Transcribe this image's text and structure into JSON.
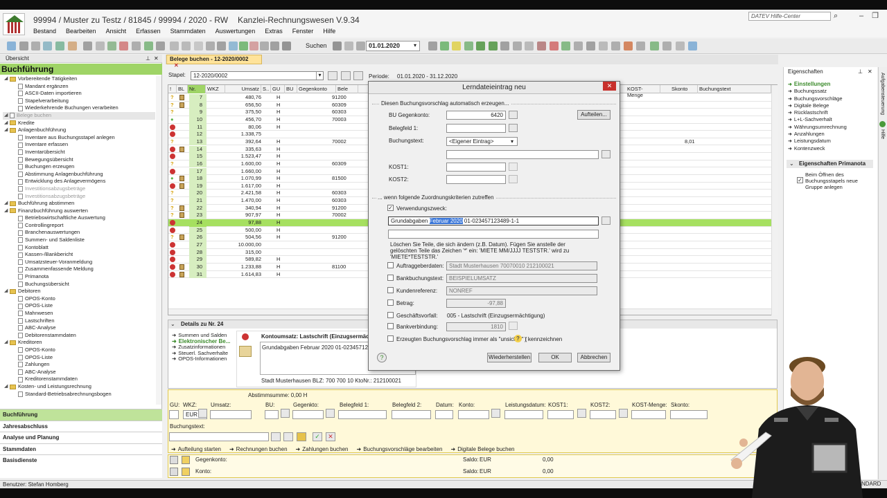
{
  "window": {
    "title": "99994 / Muster zu Testz / 81845 / 99994 / 2020 - RW",
    "app": "Kanzlei-Rechnungswesen V.9.34",
    "help_placeholder": "DATEV Hilfe-Center"
  },
  "menu": [
    "Bestand",
    "Bearbeiten",
    "Ansicht",
    "Erfassen",
    "Stammdaten",
    "Auswertungen",
    "Extras",
    "Fenster",
    "Hilfe"
  ],
  "toolbar": {
    "suchen": "Suchen",
    "date": "01.01.2020"
  },
  "leftpanel": {
    "header": "Übersicht",
    "title": "Buchführung",
    "tree": [
      {
        "t": "Vorbereitende Tätigkeiten",
        "lvl": 0,
        "f": 1
      },
      {
        "t": "Mandant ergänzen",
        "lvl": 1
      },
      {
        "t": "ASCII-Daten importieren",
        "lvl": 1
      },
      {
        "t": "Stapelverarbeitung",
        "lvl": 1
      },
      {
        "t": "Wiederkehrende Buchungen verarbeiten",
        "lvl": 1
      },
      {
        "t": "Belege buchen",
        "lvl": 0,
        "g": 1
      },
      {
        "t": "Kredite",
        "lvl": 0,
        "f": 1
      },
      {
        "t": "Anlagenbuchführung",
        "lvl": 0,
        "f": 1
      },
      {
        "t": "Inventare aus Buchungsstapel anlegen",
        "lvl": 1
      },
      {
        "t": "Inventare erfassen",
        "lvl": 1
      },
      {
        "t": "Inventarübersicht",
        "lvl": 1
      },
      {
        "t": "Bewegungsübersicht",
        "lvl": 1
      },
      {
        "t": "Buchungen erzeugen",
        "lvl": 1
      },
      {
        "t": "Abstimmung Anlagenbuchführung",
        "lvl": 1
      },
      {
        "t": "Entwicklung des Anlagevermögens",
        "lvl": 1
      },
      {
        "t": "Investitionsabzugsbeträge",
        "lvl": 1,
        "g": 1
      },
      {
        "t": "Investitionsabzugsbeträge",
        "lvl": 1,
        "g": 1
      },
      {
        "t": "Buchführung abstimmen",
        "lvl": 0,
        "f": 1
      },
      {
        "t": "Finanzbuchführung auswerten",
        "lvl": 0,
        "f": 1
      },
      {
        "t": "Betriebswirtschaftliche Auswertung",
        "lvl": 1
      },
      {
        "t": "Controllingreport",
        "lvl": 1
      },
      {
        "t": "Branchenauswertungen",
        "lvl": 1
      },
      {
        "t": "Summen- und Saldenliste",
        "lvl": 1
      },
      {
        "t": "Kontoblatt",
        "lvl": 1
      },
      {
        "t": "Kassen-/Bankbericht",
        "lvl": 1
      },
      {
        "t": "Umsatzsteuer-Voranmeldung",
        "lvl": 1
      },
      {
        "t": "Zusammenfassende Meldung",
        "lvl": 1
      },
      {
        "t": "Primanota",
        "lvl": 1
      },
      {
        "t": "Buchungsübersicht",
        "lvl": 1
      },
      {
        "t": "Debitoren",
        "lvl": 0,
        "f": 1
      },
      {
        "t": "OPOS-Konto",
        "lvl": 1
      },
      {
        "t": "OPOS-Liste",
        "lvl": 1
      },
      {
        "t": "Mahnwesen",
        "lvl": 1
      },
      {
        "t": "Lastschriften",
        "lvl": 1
      },
      {
        "t": "ABC-Analyse",
        "lvl": 1
      },
      {
        "t": "Debitorenstammdaten",
        "lvl": 1
      },
      {
        "t": "Kreditoren",
        "lvl": 0,
        "f": 1
      },
      {
        "t": "OPOS-Konto",
        "lvl": 1
      },
      {
        "t": "OPOS-Liste",
        "lvl": 1
      },
      {
        "t": "Zahlungen",
        "lvl": 1
      },
      {
        "t": "ABC-Analyse",
        "lvl": 1
      },
      {
        "t": "Kreditorenstammdaten",
        "lvl": 1
      },
      {
        "t": "Kosten- und Leistungsrechnung",
        "lvl": 0,
        "f": 1
      },
      {
        "t": "Standard-Betriebsabrechnungsbogen",
        "lvl": 1
      }
    ],
    "nav": [
      "Buchführung",
      "Jahresabschluss",
      "Analyse und Planung",
      "Stammdaten",
      "Basisdienste"
    ]
  },
  "main": {
    "tab": "Belege buchen - 12-2020/0002",
    "stapel_label": "Stapel:",
    "stapel_value": "12-2020/0002",
    "periode_label": "Periode:",
    "periode_value": "01.01.2020 - 31.12.2020",
    "columns": [
      "!",
      "BL",
      "Nr.",
      "WKZ",
      "Umsatz",
      "S..",
      "GU",
      "BU",
      "Gegenkonto",
      "Bele",
      "KOST-Menge",
      "Skonto",
      "Buchungstext"
    ],
    "rows": [
      {
        "s": "w",
        "bl": 1,
        "nr": "7",
        "u": "480,76",
        "h": "H",
        "g": "91200"
      },
      {
        "s": "w",
        "bl": 1,
        "nr": "8",
        "u": "656,50",
        "h": "H",
        "g": "60309"
      },
      {
        "s": "w",
        "bl": 0,
        "nr": "9",
        "u": "375,50",
        "h": "H",
        "g": "60303"
      },
      {
        "s": "b",
        "bl": 0,
        "nr": "10",
        "u": "456,70",
        "h": "H",
        "g": "70003"
      },
      {
        "s": "s",
        "bl": 0,
        "nr": "11",
        "u": "80,06",
        "h": "H",
        "g": ""
      },
      {
        "s": "s",
        "bl": 0,
        "nr": "12",
        "u": "1.338,75",
        "h": "",
        "g": ""
      },
      {
        "s": "w",
        "bl": 0,
        "nr": "13",
        "u": "392,64",
        "h": "H",
        "g": "70002",
        "sk": "8,01"
      },
      {
        "s": "s",
        "bl": 1,
        "nr": "14",
        "u": "335,63",
        "h": "H",
        "g": ""
      },
      {
        "s": "s",
        "bl": 0,
        "nr": "15",
        "u": "1.523,47",
        "h": "H",
        "g": ""
      },
      {
        "s": "w",
        "bl": 0,
        "nr": "16",
        "u": "1.600,00",
        "h": "H",
        "g": "60309"
      },
      {
        "s": "s",
        "bl": 0,
        "nr": "17",
        "u": "1.660,00",
        "h": "H",
        "g": ""
      },
      {
        "s": "b",
        "bl": 1,
        "nr": "18",
        "u": "1.070,99",
        "h": "H",
        "g": "81500"
      },
      {
        "s": "s",
        "bl": 1,
        "nr": "19",
        "u": "1.617,00",
        "h": "H",
        "g": ""
      },
      {
        "s": "w",
        "bl": 0,
        "nr": "20",
        "u": "2.421,58",
        "h": "H",
        "g": "60303"
      },
      {
        "s": "w",
        "bl": 0,
        "nr": "21",
        "u": "1.470,00",
        "h": "H",
        "g": "60303"
      },
      {
        "s": "w",
        "bl": 1,
        "nr": "22",
        "u": "340,94",
        "h": "H",
        "g": "91200"
      },
      {
        "s": "w",
        "bl": 1,
        "nr": "23",
        "u": "907,97",
        "h": "H",
        "g": "70002"
      },
      {
        "s": "s",
        "bl": 0,
        "nr": "24",
        "u": "97,88",
        "h": "H",
        "g": "",
        "sel": 1
      },
      {
        "s": "s",
        "bl": 0,
        "nr": "25",
        "u": "500,00",
        "h": "H",
        "g": ""
      },
      {
        "s": "w",
        "bl": 1,
        "nr": "26",
        "u": "504,56",
        "h": "H",
        "g": "91200"
      },
      {
        "s": "s",
        "bl": 0,
        "nr": "27",
        "u": "10.000,00",
        "h": "",
        "g": ""
      },
      {
        "s": "s",
        "bl": 0,
        "nr": "28",
        "u": "315,00",
        "h": "",
        "g": ""
      },
      {
        "s": "s",
        "bl": 0,
        "nr": "29",
        "u": "589,82",
        "h": "H",
        "g": ""
      },
      {
        "s": "s",
        "bl": 1,
        "nr": "30",
        "u": "1.233,88",
        "h": "H",
        "g": "81100"
      },
      {
        "s": "s",
        "bl": 1,
        "nr": "31",
        "u": "1.614,83",
        "h": "H",
        "g": ""
      }
    ]
  },
  "details": {
    "header": "Details zu Nr. 24",
    "links": [
      "Summen und Salden",
      "Elektronischer Be...",
      "Zusatzinformationen",
      "Steuerl. Sachverhalte",
      "OPOS-Informationen"
    ],
    "kontoumsatz": "Kontoumsatz: Lastschrift (Einzugsermäch",
    "text": "Grundabgaben Februar 2020 01-023457123489-",
    "bank": "Stadt Musterhausen   BLZ: 700 700 10   KtoNr.: 212100021"
  },
  "entry": {
    "abstimm": "Abstimmsumme: 0,00 H",
    "labels": [
      "GU:",
      "WKZ:",
      "Umsatz:",
      "BU:",
      "Gegenkto:",
      "Belegfeld 1:",
      "Belegfeld 2:",
      "Datum:",
      "Konto:",
      "Leistungsdatum:",
      "KOST1:",
      "KOST2:",
      "KOST-Menge:",
      "Skonto:"
    ],
    "wkz": "EUR",
    "buchungstext": "Buchungstext:",
    "actions": [
      "Aufteilung starten",
      "Rechnungen buchen",
      "Zahlungen buchen",
      "Buchungsvorschläge bearbeiten",
      "Digitale Belege buchen"
    ],
    "gegenkonto": "Gegenkonto:",
    "konto": "Konto:",
    "saldo": "Saldo:",
    "eur": "EUR",
    "zero": "0,00"
  },
  "props": {
    "header": "Eigenschaften",
    "items": [
      "Einstellungen",
      "Buchungssatz",
      "Buchungsvorschläge",
      "Digitale Belege",
      "Rücklastschrift",
      "L+L-Sachverhalt",
      "Währungsumrechnung",
      "Anzahlungen",
      "Leistungsdatum",
      "Kontenzweck"
    ],
    "primanota": "Eigenschaften Primanota",
    "primanota_check": "Beim Öffnen des Buchungsstapels neue Gruppe anlegen",
    "side": "Hilfe",
    "side2": "Aufgabensteuerung"
  },
  "status": {
    "user": "Benutzer: Stefan Homberg",
    "right": "STANDARD"
  },
  "dialog": {
    "title": "Lerndateieintrag neu",
    "sec1": "Diesen Buchungsvorschlag automatisch erzeugen...",
    "bu_label": "BU Gegenkonto:",
    "bu_value": "6420",
    "aufteilen": "Aufteilen...",
    "beleg_label": "Belegfeld 1:",
    "text_label": "Buchungstext:",
    "text_value": "<Eigener Eintrag>",
    "kost1": "KOST1:",
    "kost2": "KOST2:",
    "sec2": "... wenn folgende Zuordnungskriterien zutreffen",
    "vzweck": "Verwendungszweck:",
    "vz_a": "Grundabgaben ",
    "vz_sel": "Februar 2020",
    "vz_b": " 01-023457123489-1-1",
    "hint": "Löschen Sie Teile, die sich ändern (z.B. Datum). Fügen Sie anstelle der gelöschten Teile das Zeichen '*' ein: 'MIETE MM/JJJJ TESTSTR.' wird zu 'MIETE*TESTSTR.'",
    "crit": [
      {
        "l": "Auftraggeberdaten:",
        "v": "Stadt Musterhausen 70070010 212100021"
      },
      {
        "l": "Bankbuchungstext:",
        "v": "BEISPIELUMSATZ"
      },
      {
        "l": "Kundenreferenz:",
        "v": "NONREF"
      },
      {
        "l": "Betrag:",
        "v": "-97,88"
      },
      {
        "l": "Geschäftsvorfall:",
        "v": "005 - Lastschrift (Einzugsermächtigung)"
      },
      {
        "l": "Bankverbindung:",
        "v": "1810"
      }
    ],
    "unsicher_a": "Erzeugten Buchungsvorschlag immer als \"unsicher\" (",
    "unsicher_b": ") kennzeichnen",
    "btn_reset": "Wiederherstellen",
    "btn_ok": "OK",
    "btn_cancel": "Abbrechen"
  },
  "colors": {
    "accent_green": "#9fd466",
    "selected_row": "#a6e060",
    "stop": "#cc3333",
    "warn": "#d49e00"
  }
}
